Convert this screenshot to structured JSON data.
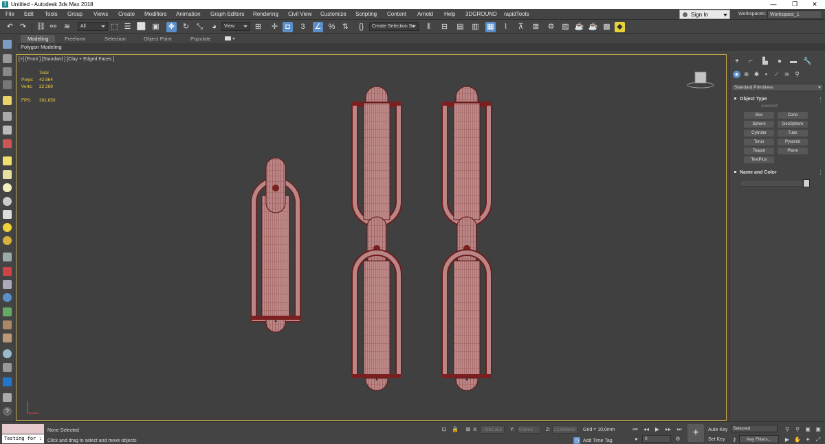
{
  "window": {
    "title": "Untitled - Autodesk 3ds Max 2018",
    "app_icon": "3ds-max-icon",
    "minimize": "—",
    "maximize": "❐",
    "close": "✕"
  },
  "menu": {
    "items": [
      "File",
      "Edit",
      "Tools",
      "Group",
      "Views",
      "Create",
      "Modifiers",
      "Animation",
      "Graph Editors",
      "Rendering",
      "Civil View",
      "Customize",
      "Scripting",
      "Content",
      "Arnold",
      "Help",
      "3DGROUND",
      "rapidTools"
    ],
    "sign_in": "Sign In",
    "workspaces_label": "Workspaces:",
    "workspace_value": "Workspace_1"
  },
  "toolbar": {
    "selection_filter": "All",
    "ref_coord": "View",
    "named_selection": "Create Selection Se"
  },
  "ribbon": {
    "tabs": [
      "Modeling",
      "Freeform",
      "Selection",
      "Object Paint",
      "Populate"
    ],
    "active_tab": "Modeling",
    "sub_label": "Polygon Modeling"
  },
  "viewport": {
    "label": "[+] [Front ] [Standard ] [Clay + Edged Faces ]",
    "stats": {
      "total_label": "Total",
      "polys_label": "Polys:",
      "polys_value": "42 864",
      "verts_label": "Verts:",
      "verts_value": "22 269",
      "fps_label": "FPS:",
      "fps_value": "392,650"
    },
    "axis_x": "x",
    "axis_y": "y"
  },
  "command_panel": {
    "category": "Standard Primitives",
    "object_type_title": "Object Type",
    "autogrid": "AutoGrid",
    "buttons": [
      "Box",
      "Cone",
      "Sphere",
      "GeoSphere",
      "Cylinder",
      "Tube",
      "Torus",
      "Pyramid",
      "Teapot",
      "Plane",
      "TextPlus"
    ],
    "name_color_title": "Name and Color"
  },
  "status": {
    "maxscript_input": "Testing for :",
    "selection_status": "None Selected",
    "prompt": "Click and drag to select and move objects",
    "x_label": "X:",
    "x_value": "-7092,352",
    "y_label": "Y:",
    "y_value": "0,0mm",
    "z_label": "Z:",
    "z_value": "12,608mm",
    "grid": "Grid = 10,0mm",
    "add_time_tag": "Add Time Tag",
    "frame": "0",
    "auto_key": "Auto Key",
    "set_key": "Set Key",
    "selected_dropdown": "Selected",
    "key_filters": "Key Filters..."
  },
  "colors": {
    "viewport_border": "#c8a94a",
    "mesh_fill": "#b88080",
    "mesh_wire": "#7a1f1f",
    "stats_text": "#f2d23a",
    "accent": "#5b8fc9"
  }
}
